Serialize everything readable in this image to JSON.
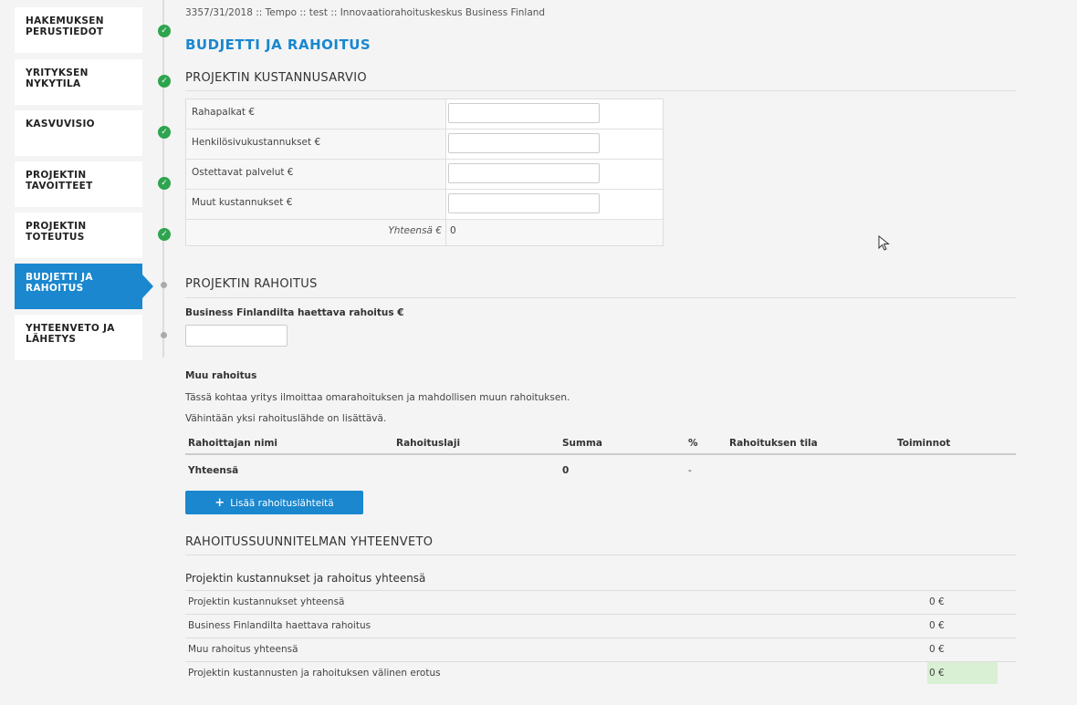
{
  "sidebar": {
    "steps": [
      {
        "line1": "HAKEMUKSEN",
        "line2": "PERUSTIEDOT",
        "status": "done"
      },
      {
        "line1": "YRITYKSEN",
        "line2": "NYKYTILA",
        "status": "done"
      },
      {
        "line1": "KASVUVISIO",
        "line2": "",
        "status": "done"
      },
      {
        "line1": "PROJEKTIN",
        "line2": "TAVOITTEET",
        "status": "done"
      },
      {
        "line1": "PROJEKTIN",
        "line2": "TOTEUTUS",
        "status": "done"
      },
      {
        "line1": "BUDJETTI JA",
        "line2": "RAHOITUS",
        "status": "active"
      },
      {
        "line1": "YHTEENVETO JA",
        "line2": "LÄHETYS",
        "status": "pending"
      }
    ]
  },
  "breadcrumb": "3357/31/2018 :: Tempo :: test :: Innovaatiorahoituskeskus Business Finland",
  "page_title": "BUDJETTI JA RAHOITUS",
  "cost": {
    "heading": "PROJEKTIN KUSTANNUSARVIO",
    "rows": [
      {
        "label": "Rahapalkat €",
        "value": ""
      },
      {
        "label": "Henkilösivukustannukset €",
        "value": ""
      },
      {
        "label": "Ostettavat palvelut €",
        "value": ""
      },
      {
        "label": "Muut kustannukset €",
        "value": ""
      }
    ],
    "total_label": "Yhteensä €",
    "total_value": "0"
  },
  "funding": {
    "heading": "PROJEKTIN RAHOITUS",
    "bf_label": "Business Finlandilta haettava rahoitus €",
    "bf_value": "",
    "other_heading": "Muu rahoitus",
    "other_desc1": "Tässä kohtaa yritys ilmoittaa omarahoituksen ja mahdollisen muun rahoituksen.",
    "other_desc2": "Vähintään yksi rahoituslähde on lisättävä.",
    "columns": [
      "Rahoittajan nimi",
      "Rahoituslaji",
      "Summa",
      "%",
      "Rahoituksen tila",
      "Toiminnot"
    ],
    "total": {
      "label": "Yhteensä",
      "summa": "0",
      "percent": "-"
    },
    "add_button": "Lisää rahoituslähteitä"
  },
  "summary": {
    "heading": "RAHOITUSSUUNNITELMAN YHTEENVETO",
    "subheading": "Projektin kustannukset ja rahoitus yhteensä",
    "rows": [
      {
        "label": "Projektin kustannukset yhteensä",
        "value": "0 €"
      },
      {
        "label": "Business Finlandilta haettava rahoitus",
        "value": "0 €"
      },
      {
        "label": "Muu rahoitus yhteensä",
        "value": "0 €"
      },
      {
        "label": "Projektin kustannusten ja rahoituksen välinen erotus",
        "value": "0 €"
      }
    ]
  },
  "colors": {
    "accent": "#1a87cf",
    "done": "#2ea44f",
    "highlight": "#d9f0d5"
  }
}
